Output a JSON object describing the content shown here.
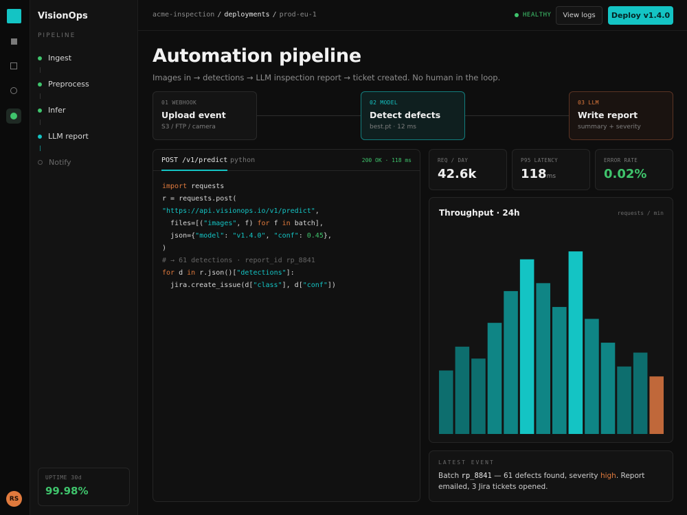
{
  "sidebar": {
    "brand": "VisionOps",
    "section_title": "PIPELINE",
    "steps": [
      {
        "label": "Ingest",
        "state": "done"
      },
      {
        "label": "Preprocess",
        "state": "done"
      },
      {
        "label": "Infer",
        "state": "done"
      },
      {
        "label": "LLM report",
        "state": "active"
      },
      {
        "label": "Notify",
        "state": "pending"
      }
    ],
    "uptime_label": "UPTIME 30d",
    "uptime_value": "99.98%",
    "avatar_initials": "RS"
  },
  "header": {
    "crumbs": [
      "acme-inspection",
      "deployments",
      "prod-eu-1"
    ],
    "status": "HEALTHY",
    "view_logs_label": "View logs",
    "deploy_label": "Deploy v1.4.0"
  },
  "page": {
    "title": "Automation pipeline",
    "subtitle": "Images in → detections → LLM inspection report → ticket created. No human in the loop."
  },
  "pipeline_cards": [
    {
      "tag": "01 WEBHOOK",
      "name": "Upload event",
      "meta": "S3 / FTP / camera"
    },
    {
      "tag": "02 MODEL",
      "name": "Detect defects",
      "meta": "best.pt · 12 ms"
    },
    {
      "tag": "03 LLM",
      "name": "Write report",
      "meta": "summary + severity"
    }
  ],
  "code": {
    "tab_active": "POST /v1/predict",
    "tab_other": "python",
    "status": "200 OK · 118 ms",
    "lines": [
      {
        "import": "import",
        "rest": " requests"
      },
      "r = requests.post(",
      "\"https://api.visionops.io/v1/predict\",",
      "  files=[(\"images\", f) for f in batch],",
      "  json={\"model\": \"v1.4.0\", \"conf\": 0.45},",
      ")",
      "# → 61 detections · report_id rp_8841",
      "for d in r.json()[\"detections\"]:",
      "  jira.create_issue(d[\"class\"], d[\"conf\"])"
    ]
  },
  "stats": [
    {
      "label": "REQ / DAY",
      "value": "42.6k",
      "unit": ""
    },
    {
      "label": "P95 LATENCY",
      "value": "118",
      "unit": "ms"
    },
    {
      "label": "ERROR RATE",
      "value": "0.02%",
      "unit": ""
    }
  ],
  "chart_data": {
    "type": "bar",
    "title": "Throughput · 24h",
    "unit_label": "requests / min",
    "values": [
      32,
      44,
      38,
      56,
      72,
      88,
      76,
      64,
      92,
      58,
      46,
      34,
      41,
      29
    ],
    "ylim": [
      0,
      100
    ],
    "colors": {
      "normal": "#0f8585",
      "peak": "#14c4c4",
      "low": "#0d6e6e",
      "latest": "#c0683a"
    }
  },
  "latest_event": {
    "label": "LATEST EVENT",
    "text_before": "Batch ",
    "report_id": "rp_8841",
    "text_mid": " — 61 defects found, severity ",
    "severity": "high",
    "text_after": ". Report emailed, 3 Jira tickets opened."
  }
}
